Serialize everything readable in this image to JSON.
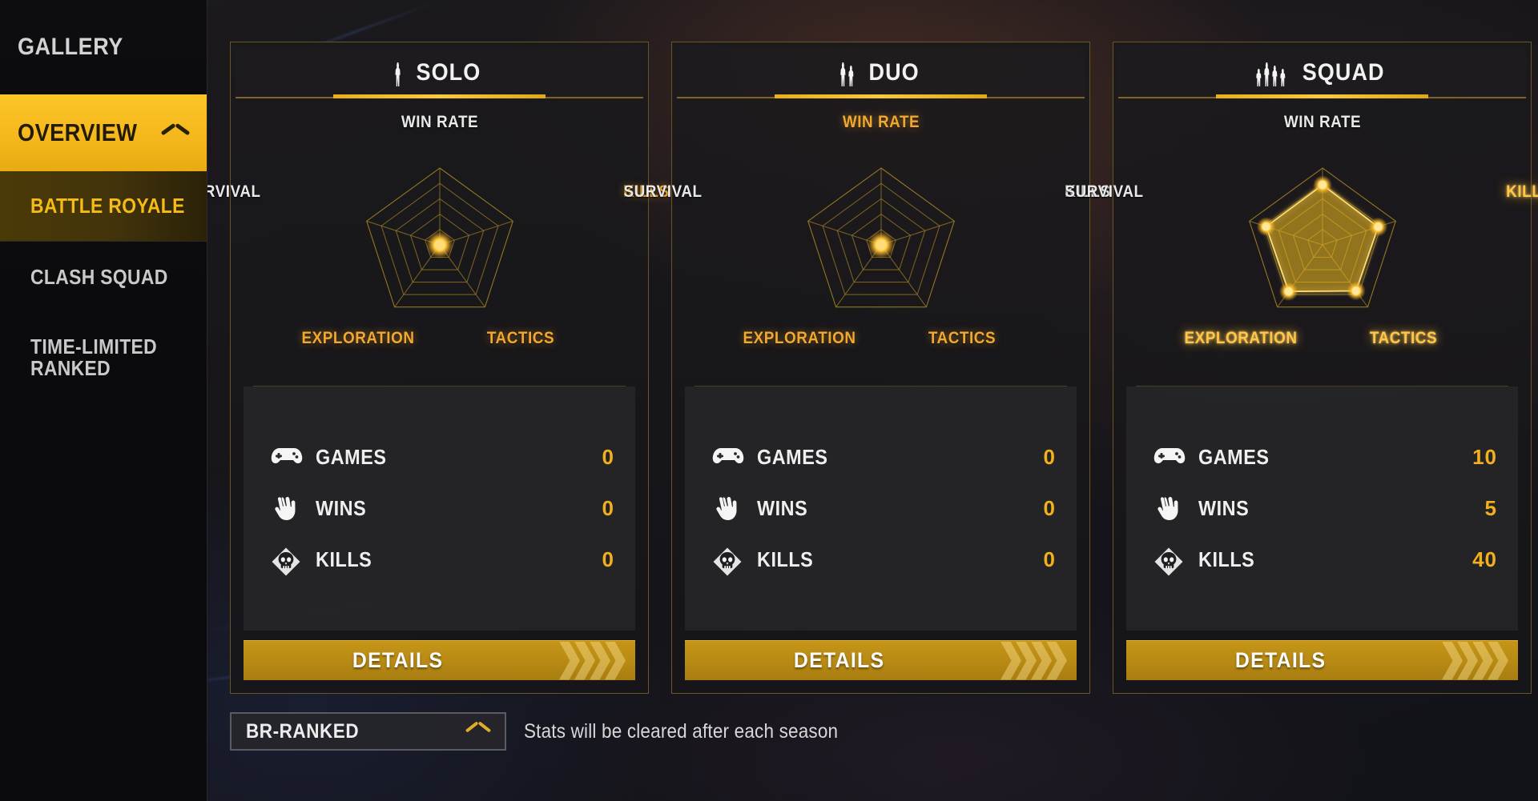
{
  "sidebar": {
    "items": [
      {
        "label": "GALLERY",
        "state": "normal",
        "icon": ""
      },
      {
        "label": "OVERVIEW",
        "state": "selected",
        "icon": "chevron-up-icon"
      },
      {
        "label": "BATTLE ROYALE",
        "state": "active-sub"
      },
      {
        "label": "CLASH SQUAD",
        "state": "sub"
      },
      {
        "label": "TIME-LIMITED\nRANKED",
        "state": "sub"
      }
    ]
  },
  "cards": [
    {
      "id": "solo",
      "title": "SOLO",
      "icon": "single-person-icon",
      "figures": 1,
      "stats": [
        {
          "icon": "gamepad-icon",
          "label": "GAMES",
          "value": "0"
        },
        {
          "icon": "peace-hand-icon",
          "label": "WINS",
          "value": "0"
        },
        {
          "icon": "skull-icon",
          "label": "KILLS",
          "value": "0"
        }
      ],
      "details_label": "DETAILS"
    },
    {
      "id": "duo",
      "title": "DUO",
      "icon": "two-person-icon",
      "figures": 2,
      "stats": [
        {
          "icon": "gamepad-icon",
          "label": "GAMES",
          "value": "0"
        },
        {
          "icon": "peace-hand-icon",
          "label": "WINS",
          "value": "0"
        },
        {
          "icon": "skull-icon",
          "label": "KILLS",
          "value": "0"
        }
      ],
      "details_label": "DETAILS"
    },
    {
      "id": "squad",
      "title": "SQUAD",
      "icon": "four-person-icon",
      "figures": 4,
      "stats": [
        {
          "icon": "gamepad-icon",
          "label": "GAMES",
          "value": "10"
        },
        {
          "icon": "peace-hand-icon",
          "label": "WINS",
          "value": "5"
        },
        {
          "icon": "skull-icon",
          "label": "KILLS",
          "value": "40"
        }
      ],
      "details_label": "DETAILS"
    }
  ],
  "bottom": {
    "selector_label": "BR-RANKED",
    "selector_icon": "chevron-up-icon",
    "hint": "Stats will be cleared after each season"
  },
  "colors": {
    "accent_yellow": "#f5bb16",
    "accent_gold": "#c59518",
    "axis_gold": "#f0a830",
    "label_white": "#e9e9e9",
    "panel_bg": "#1a191c",
    "sidebar_bg": "#0d0d0f"
  },
  "chart_data": [
    {
      "type": "radar",
      "title": "SOLO",
      "categories": [
        "WIN RATE",
        "KILLS",
        "TACTICS",
        "EXPLORATION",
        "SURVIVAL"
      ],
      "category_colors": [
        "white",
        "gold",
        "gold",
        "gold",
        "white"
      ],
      "values": [
        0,
        0,
        0,
        0,
        0
      ],
      "max": 100,
      "rings": 5,
      "grid": true
    },
    {
      "type": "radar",
      "title": "DUO",
      "categories": [
        "WIN RATE",
        "KILLS",
        "TACTICS",
        "EXPLORATION",
        "SURVIVAL"
      ],
      "category_colors": [
        "gold",
        "white",
        "gold",
        "gold",
        "white"
      ],
      "values": [
        0,
        0,
        0,
        0,
        0
      ],
      "max": 100,
      "rings": 5,
      "grid": true
    },
    {
      "type": "radar",
      "title": "SQUAD",
      "categories": [
        "WIN RATE",
        "KILLS",
        "TACTICS",
        "EXPLORATION",
        "SURVIVAL"
      ],
      "category_colors": [
        "white",
        "glow",
        "glow",
        "glow",
        "white"
      ],
      "values": [
        78,
        76,
        74,
        75,
        77
      ],
      "max": 100,
      "rings": 5,
      "grid": true
    }
  ]
}
